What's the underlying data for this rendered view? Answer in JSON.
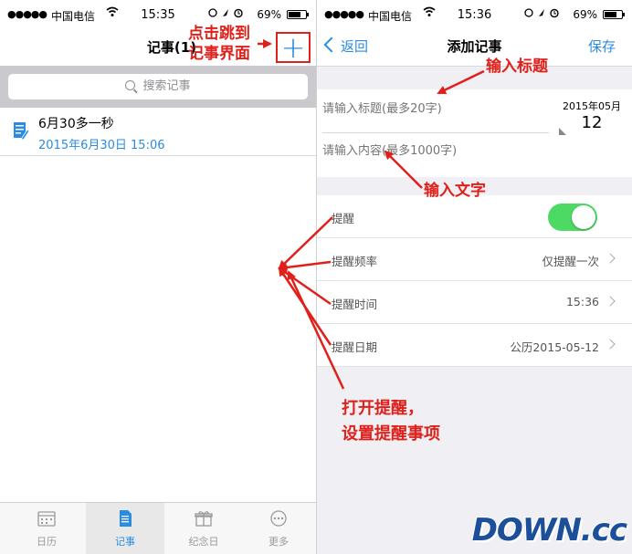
{
  "left_screen": {
    "status": {
      "carrier": "中国电信",
      "time": "15:35",
      "battery": "69%"
    },
    "nav_title": "记事(1)",
    "add_icon": "plus-icon",
    "search_placeholder": "搜索记事",
    "notes": [
      {
        "title": "6月30多一秒",
        "date": "2015年6月30日 15:06"
      }
    ],
    "tabs": [
      {
        "label": "日历",
        "icon": "calendar-icon",
        "active": false
      },
      {
        "label": "记事",
        "icon": "note-icon",
        "active": true
      },
      {
        "label": "纪念日",
        "icon": "gift-icon",
        "active": false
      },
      {
        "label": "更多",
        "icon": "more-icon",
        "active": false
      }
    ]
  },
  "right_screen": {
    "status": {
      "carrier": "中国电信",
      "time": "15:36",
      "battery": "69%"
    },
    "back_label": "返回",
    "nav_title": "添加记事",
    "save_label": "保存",
    "title_placeholder": "请输入标题(最多20字)",
    "content_placeholder": "请输入内容(最多1000字)",
    "date_badge": {
      "year_month": "2015年05月",
      "day": "12"
    },
    "settings": [
      {
        "label": "提醒",
        "value": "",
        "toggle": true
      },
      {
        "label": "提醒频率",
        "value": "仅提醒一次"
      },
      {
        "label": "提醒时间",
        "value": "15:36"
      },
      {
        "label": "提醒日期",
        "value": "公历2015-05-12"
      }
    ]
  },
  "annotations": {
    "click_add_line1": "点击跳到",
    "click_add_line2": "记事界面",
    "input_title": "输入标题",
    "input_text": "输入文字",
    "reminder_line1": "打开提醒，",
    "reminder_line2": "设置提醒事项",
    "color": "#e0201a"
  },
  "watermark": "DOWN.cc",
  "colors": {
    "accent": "#2a8ce0",
    "toggle_on": "#4cd964",
    "annotation": "#e0201a"
  }
}
